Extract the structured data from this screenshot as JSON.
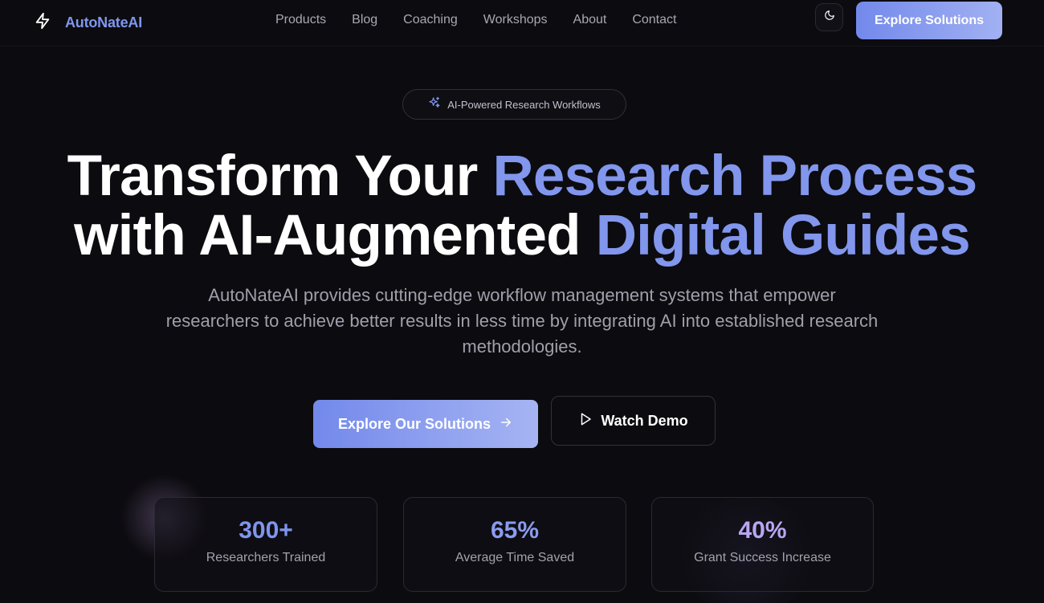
{
  "brand": {
    "name": "AutoNateAI",
    "icon": "lightning-bolt-icon"
  },
  "nav": {
    "links": [
      "Products",
      "Blog",
      "Coaching",
      "Workshops",
      "About",
      "Contact"
    ],
    "theme_icon": "moon-icon",
    "cta_label": "Explore Solutions"
  },
  "hero": {
    "badge": {
      "icon": "sparkles-icon",
      "text": "AI-Powered Research Workflows"
    },
    "headline": {
      "line1_plain": "Transform Your ",
      "line1_accent": "Research Process",
      "line2_plain": "with AI-Augmented ",
      "line2_accent": "Digital Guides"
    },
    "subtitle": "AutoNateAI provides cutting-edge workflow management systems that empower researchers to achieve better results in less time by integrating AI into established research methodologies.",
    "primary_button": {
      "label": "Explore Our Solutions",
      "icon": "arrow-right-icon"
    },
    "secondary_button": {
      "label": "Watch Demo",
      "icon": "play-icon"
    }
  },
  "stats": [
    {
      "value": "300+",
      "label": "Researchers Trained",
      "color": "#7f95ec"
    },
    {
      "value": "65%",
      "label": "Average Time Saved",
      "color": "#8a9cee"
    },
    {
      "value": "40%",
      "label": "Grant Success Increase",
      "color": "#b9a6f2"
    }
  ],
  "colors": {
    "background": "#0c0b0f",
    "accent": "#8196ec",
    "button_gradient_start": "#7389eb",
    "button_gradient_end": "#a6b4f3"
  }
}
